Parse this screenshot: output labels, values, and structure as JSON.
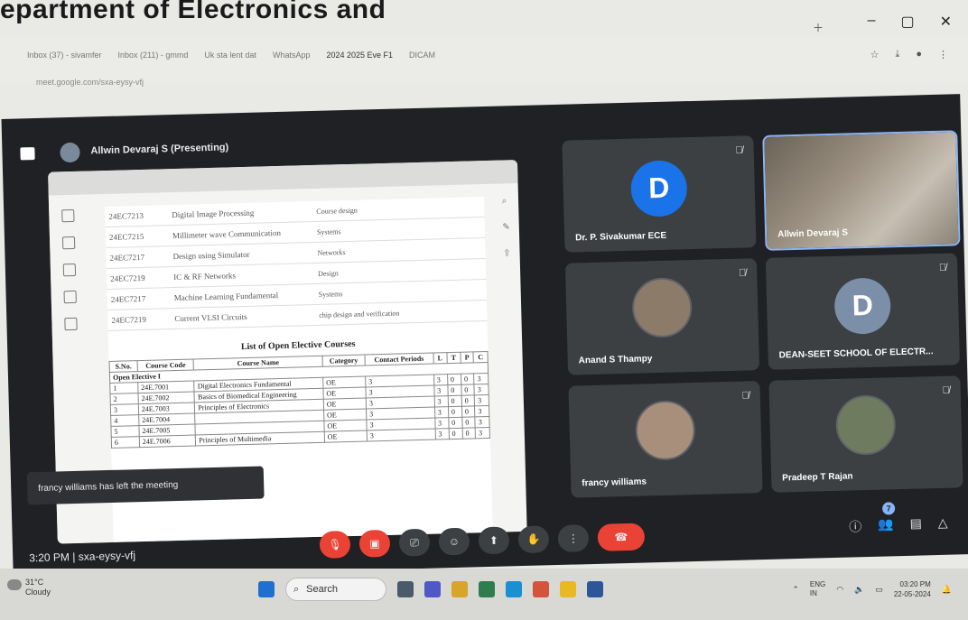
{
  "banner": {
    "text": "epartment of Electronics and"
  },
  "browser": {
    "tabs": [
      {
        "label": "Inbox (37) - sivamfer"
      },
      {
        "label": "Inbox (211) - gmmd"
      },
      {
        "label": "Uk sta lent dat"
      },
      {
        "label": "WhatsApp"
      },
      {
        "label": "2024 2025 Eve F1"
      },
      {
        "label": "DICAM"
      }
    ],
    "address": "meet.google.com/sxa-eysy-vfj",
    "window_controls": [
      "–",
      "▢",
      "✕"
    ]
  },
  "meet": {
    "presenter": "Allwin Devaraj S (Presenting)",
    "participants": [
      {
        "name": "Dr. P. Sivakumar ECE",
        "avatar_letter": "D",
        "type": "letter"
      },
      {
        "name": "Allwin Devaraj S",
        "type": "video"
      },
      {
        "name": "Anand S Thampy",
        "type": "photo"
      },
      {
        "name": "DEAN-SEET SCHOOL OF ELECTR...",
        "avatar_letter": "D",
        "type": "letter"
      },
      {
        "name": "francy williams",
        "type": "photo"
      },
      {
        "name": "Pradeep T Rajan",
        "type": "photo"
      }
    ],
    "toast": "francy williams has left the meeting",
    "time": "3:20 PM",
    "meeting_code": "sxa-eysy-vfj",
    "participant_count": "7"
  },
  "document": {
    "course_rows": [
      {
        "code": "24EC7213",
        "name": "Digital Image Processing",
        "desc": "Course design"
      },
      {
        "code": "24EC7215",
        "name": "Millimeter wave Communication",
        "desc": "Systems"
      },
      {
        "code": "24EC7217",
        "name": "Design using Simulator",
        "desc": "Networks"
      },
      {
        "code": "24EC7219",
        "name": "IC & RF Networks",
        "desc": "Design"
      },
      {
        "code": "24EC7217",
        "name": "Machine Learning Fundamental",
        "desc": "Systems"
      },
      {
        "code": "24EC7219",
        "name": "Current VLSI Circuits",
        "desc": "chip design and verification"
      }
    ],
    "open_elective_title": "List of Open Elective Courses",
    "headers": [
      "S.No.",
      "Course Code",
      "Course Name",
      "Category",
      "Contact Periods",
      "L",
      "T",
      "P",
      "C"
    ],
    "section": "Open Elective I",
    "rows": [
      [
        "1",
        "24E.7001",
        "Digital Electronics Fundamental",
        "OE",
        "3",
        "3",
        "0",
        "0",
        "3"
      ],
      [
        "2",
        "24E.7002",
        "Basics of Biomedical Engineering",
        "OE",
        "3",
        "3",
        "0",
        "0",
        "3"
      ],
      [
        "3",
        "24E.7003",
        "Principles of Electronics",
        "OE",
        "3",
        "3",
        "0",
        "0",
        "3"
      ],
      [
        "4",
        "24E.7004",
        "",
        "OE",
        "3",
        "3",
        "0",
        "0",
        "3"
      ],
      [
        "5",
        "24E.7005",
        "",
        "OE",
        "3",
        "3",
        "0",
        "0",
        "3"
      ],
      [
        "6",
        "24E.7006",
        "Principles of Multimedia",
        "OE",
        "3",
        "3",
        "0",
        "0",
        "3"
      ]
    ]
  },
  "taskbar": {
    "weather_temp": "31°C",
    "weather_desc": "Cloudy",
    "search": "Search",
    "lang": "ENG",
    "region": "IN",
    "clock": "03:20 PM",
    "date": "22-05-2024"
  }
}
